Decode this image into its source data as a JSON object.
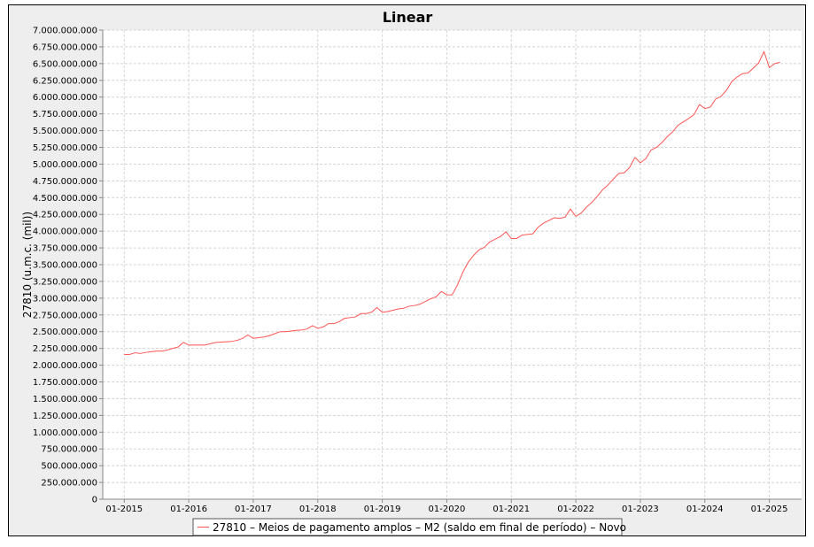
{
  "chart_data": {
    "type": "line",
    "title": "Linear",
    "xlabel": "",
    "ylabel": "27810 (u.m.c. (mil))",
    "ylim": [
      0,
      7000000000
    ],
    "y_ticks": [
      0,
      250000000,
      500000000,
      750000000,
      1000000000,
      1250000000,
      1500000000,
      1750000000,
      2000000000,
      2250000000,
      2500000000,
      2750000000,
      3000000000,
      3250000000,
      3500000000,
      3750000000,
      4000000000,
      4250000000,
      4500000000,
      4750000000,
      5000000000,
      5250000000,
      5500000000,
      5750000000,
      6000000000,
      6250000000,
      6500000000,
      6750000000,
      7000000000
    ],
    "y_tick_labels": [
      "0",
      "250.000.000",
      "500.000.000",
      "750.000.000",
      "1.000.000.000",
      "1.250.000.000",
      "1.500.000.000",
      "1.750.000.000",
      "2.000.000.000",
      "2.250.000.000",
      "2.500.000.000",
      "2.750.000.000",
      "3.000.000.000",
      "3.250.000.000",
      "3.500.000.000",
      "3.750.000.000",
      "4.000.000.000",
      "4.250.000.000",
      "4.500.000.000",
      "4.750.000.000",
      "5.000.000.000",
      "5.250.000.000",
      "5.500.000.000",
      "5.750.000.000",
      "6.000.000.000",
      "6.250.000.000",
      "6.500.000.000",
      "6.750.000.000",
      "7.000.000.000"
    ],
    "x_ticks": [
      "2015-01",
      "2016-01",
      "2017-01",
      "2018-01",
      "2019-01",
      "2020-01",
      "2021-01",
      "2022-01",
      "2023-01",
      "2024-01",
      "2025-01"
    ],
    "x_tick_labels": [
      "01-2015",
      "01-2016",
      "01-2017",
      "01-2018",
      "01-2019",
      "01-2020",
      "01-2021",
      "01-2022",
      "01-2023",
      "01-2024",
      "01-2025"
    ],
    "x_range": [
      "2014-09",
      "2025-07"
    ],
    "grid": true,
    "legend_position": "bottom",
    "series": [
      {
        "name": "27810 – Meios de pagamento amplos – M2 (saldo em final de período) – Novo",
        "color": "#ff5555",
        "start": "2015-01",
        "frequency": "monthly",
        "values": [
          2160000000,
          2160000000,
          2185000000,
          2175000000,
          2190000000,
          2200000000,
          2210000000,
          2210000000,
          2225000000,
          2250000000,
          2270000000,
          2340000000,
          2300000000,
          2300000000,
          2300000000,
          2300000000,
          2320000000,
          2340000000,
          2345000000,
          2350000000,
          2355000000,
          2370000000,
          2400000000,
          2450000000,
          2400000000,
          2410000000,
          2420000000,
          2440000000,
          2470000000,
          2500000000,
          2500000000,
          2510000000,
          2520000000,
          2525000000,
          2540000000,
          2590000000,
          2550000000,
          2570000000,
          2620000000,
          2620000000,
          2650000000,
          2700000000,
          2710000000,
          2720000000,
          2770000000,
          2770000000,
          2790000000,
          2860000000,
          2790000000,
          2800000000,
          2820000000,
          2840000000,
          2850000000,
          2880000000,
          2890000000,
          2910000000,
          2950000000,
          2990000000,
          3020000000,
          3100000000,
          3050000000,
          3050000000,
          3200000000,
          3390000000,
          3540000000,
          3640000000,
          3720000000,
          3760000000,
          3840000000,
          3880000000,
          3920000000,
          3990000000,
          3890000000,
          3890000000,
          3940000000,
          3950000000,
          3960000000,
          4060000000,
          4120000000,
          4160000000,
          4200000000,
          4190000000,
          4210000000,
          4330000000,
          4220000000,
          4270000000,
          4360000000,
          4430000000,
          4520000000,
          4620000000,
          4690000000,
          4780000000,
          4860000000,
          4870000000,
          4950000000,
          5100000000,
          5020000000,
          5080000000,
          5210000000,
          5250000000,
          5320000000,
          5410000000,
          5480000000,
          5580000000,
          5630000000,
          5680000000,
          5740000000,
          5890000000,
          5830000000,
          5850000000,
          5970000000,
          6010000000,
          6100000000,
          6230000000,
          6300000000,
          6350000000,
          6360000000,
          6430000000,
          6510000000,
          6680000000,
          6440000000,
          6500000000,
          6520000000
        ]
      }
    ]
  }
}
